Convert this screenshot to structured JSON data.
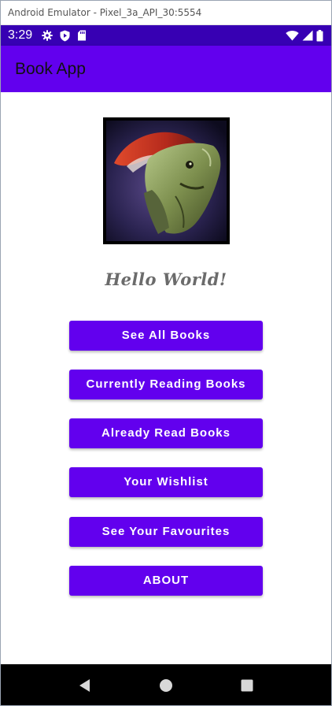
{
  "window": {
    "title": "Android Emulator - Pixel_3a_API_30:5554"
  },
  "status_bar": {
    "time": "3:29",
    "left_icons": [
      "gear-icon",
      "shield-icon",
      "sd-card-icon"
    ],
    "right_icons": [
      "wifi-icon",
      "signal-icon",
      "battery-icon"
    ],
    "color": "#3700b3"
  },
  "app_bar": {
    "title": "Book App",
    "color": "#6200ee"
  },
  "main": {
    "cover_image": "book-cover-creature-icon",
    "greeting": "Hello World!",
    "buttons": [
      {
        "label": "See All Books"
      },
      {
        "label": "Currently Reading Books"
      },
      {
        "label": "Already Read Books"
      },
      {
        "label": "Your Wishlist"
      },
      {
        "label": "See Your Favourites"
      },
      {
        "label": "ABOUT"
      }
    ],
    "button_color": "#6200ee"
  },
  "nav_bar": {
    "icons": [
      "back-icon",
      "home-icon",
      "recents-icon"
    ]
  }
}
